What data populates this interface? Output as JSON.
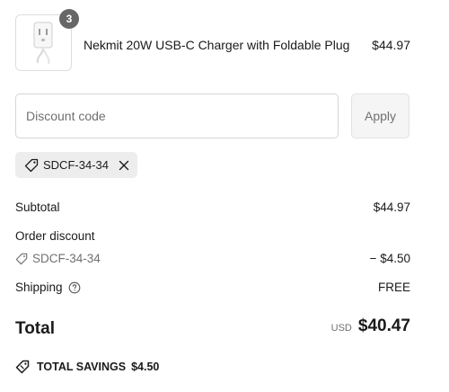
{
  "product": {
    "quantity": "3",
    "name": "Nekmit 20W USB-C Charger with Foldable Plug",
    "price": "$44.97",
    "image_icon": "usb-c-charger-image"
  },
  "discount": {
    "placeholder": "Discount code",
    "value": "",
    "apply_label": "Apply",
    "applied_code": "SDCF-34-34"
  },
  "summary": {
    "subtotal_label": "Subtotal",
    "subtotal_value": "$44.97",
    "order_discount_label": "Order discount",
    "discount_code": "SDCF-34-34",
    "discount_value": "− $4.50",
    "shipping_label": "Shipping",
    "shipping_value": "FREE"
  },
  "total": {
    "label": "Total",
    "currency": "USD",
    "amount": "$40.47"
  },
  "savings": {
    "label": "TOTAL SAVINGS",
    "amount": "$4.50"
  },
  "colors": {
    "text": "#1a1a1a",
    "muted": "#707070",
    "chip_bg": "#ededed",
    "badge_bg": "#666666",
    "button_bg": "#f5f5f5"
  }
}
